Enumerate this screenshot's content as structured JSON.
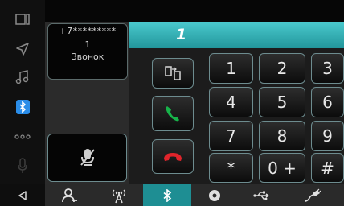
{
  "call": {
    "number_masked": "+7*********",
    "count": "1",
    "label": "Звонок",
    "dialed": "1"
  },
  "keypad": {
    "keys": [
      "1",
      "2",
      "3",
      "4",
      "5",
      "6",
      "7",
      "8",
      "9",
      "*",
      "0 +",
      "#"
    ]
  },
  "colors": {
    "accent": "#2fb3b8",
    "answer": "#17b34a",
    "hangup": "#e0242b",
    "bluetooth": "#2a8de8"
  },
  "sidebar": {
    "items": [
      "panel-icon",
      "navigation-icon",
      "music-icon",
      "bluetooth-icon",
      "more-icon",
      "microphone-icon"
    ]
  },
  "bottom_tabs": {
    "items": [
      "contacts-icon",
      "radio-icon",
      "bluetooth-icon",
      "disc-icon",
      "usb-icon",
      "link-icon"
    ],
    "active": "bluetooth-icon"
  }
}
